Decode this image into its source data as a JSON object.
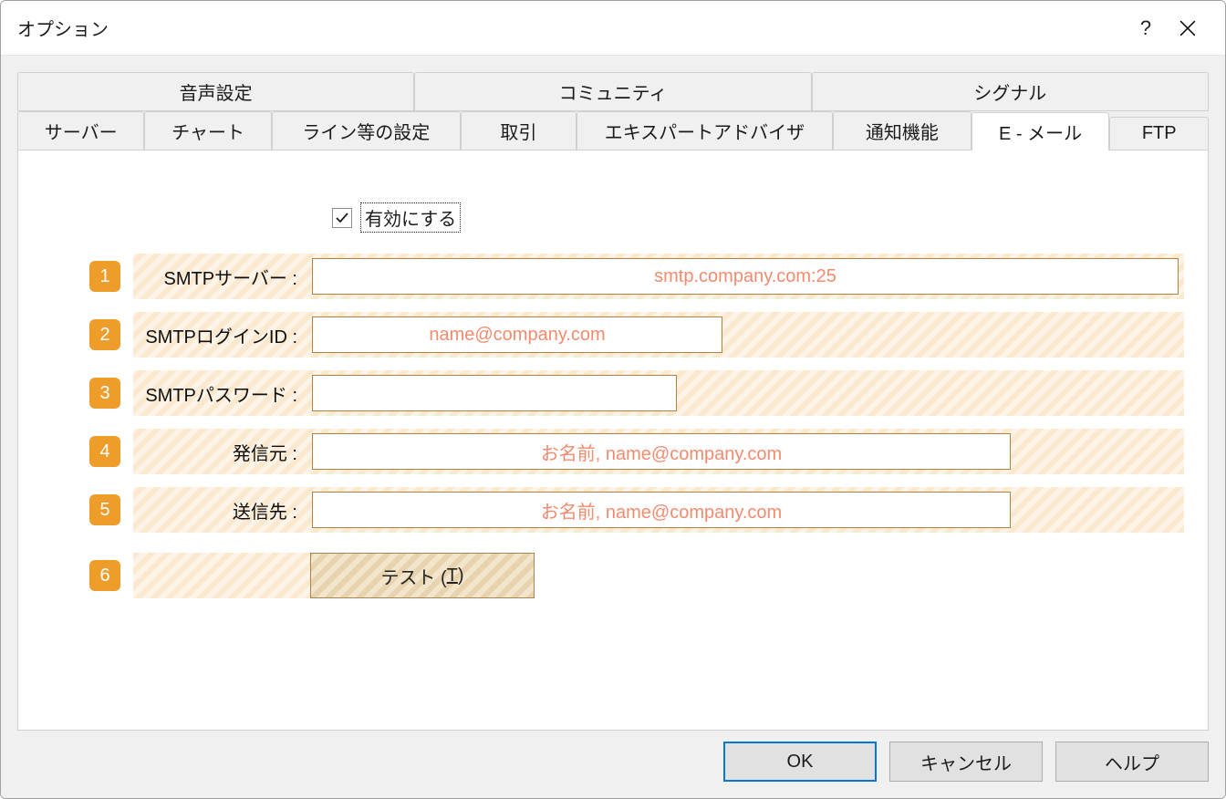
{
  "window": {
    "title": "オプション"
  },
  "tabs": {
    "row1": [
      {
        "label": "音声設定"
      },
      {
        "label": "コミュニティ"
      },
      {
        "label": "シグナル"
      }
    ],
    "row2": [
      {
        "label": "サーバー"
      },
      {
        "label": "チャート"
      },
      {
        "label": "ライン等の設定"
      },
      {
        "label": "取引"
      },
      {
        "label": "エキスパートアドバイザ"
      },
      {
        "label": "通知機能"
      },
      {
        "label": "E - メール"
      },
      {
        "label": "FTP"
      }
    ]
  },
  "form": {
    "enable_checkbox_label": "有効にする",
    "rows": [
      {
        "num": "1",
        "label": "SMTPサーバー :",
        "value": "smtp.company.com:25"
      },
      {
        "num": "2",
        "label": "SMTPログインID :",
        "value": "name@company.com"
      },
      {
        "num": "3",
        "label": "SMTPパスワード :",
        "value": ""
      },
      {
        "num": "4",
        "label": "発信元 :",
        "value": "お名前, name@company.com"
      },
      {
        "num": "5",
        "label": "送信先 :",
        "value": "お名前, name@company.com"
      },
      {
        "num": "6",
        "button_prefix": "テスト (",
        "button_mnemonic": "T",
        "button_suffix": ")"
      }
    ]
  },
  "buttons": {
    "ok": "OK",
    "cancel": "キャンセル",
    "help": "ヘルプ"
  }
}
